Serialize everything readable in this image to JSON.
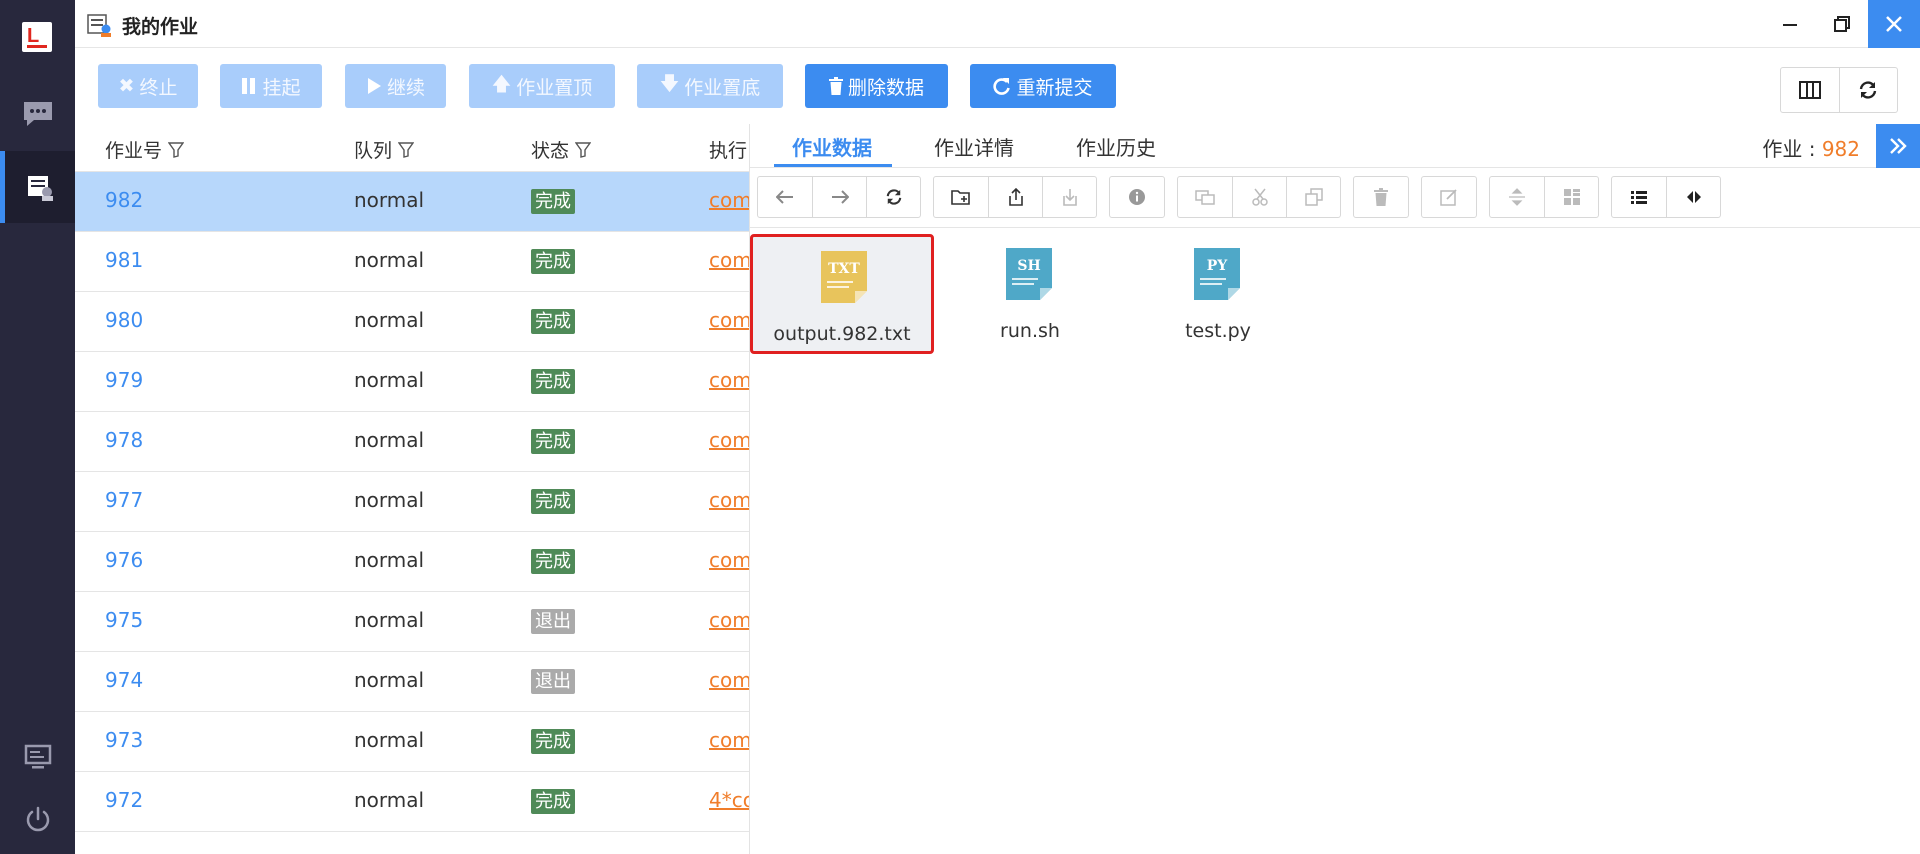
{
  "window": {
    "title": "我的作业"
  },
  "toolbar": {
    "terminate": "终止",
    "suspend": "挂起",
    "resume": "继续",
    "pin_top": "作业置顶",
    "pin_bottom": "作业置底",
    "delete_data": "删除数据",
    "resubmit": "重新提交"
  },
  "table": {
    "headers": {
      "job_id": "作业号",
      "queue": "队列",
      "status": "状态",
      "exec": "执行"
    },
    "rows": [
      {
        "id": "982",
        "queue": "normal",
        "status": "完成",
        "kind": "done",
        "cmd": "com",
        "selected": true
      },
      {
        "id": "981",
        "queue": "normal",
        "status": "完成",
        "kind": "done",
        "cmd": "com"
      },
      {
        "id": "980",
        "queue": "normal",
        "status": "完成",
        "kind": "done",
        "cmd": "com"
      },
      {
        "id": "979",
        "queue": "normal",
        "status": "完成",
        "kind": "done",
        "cmd": "com"
      },
      {
        "id": "978",
        "queue": "normal",
        "status": "完成",
        "kind": "done",
        "cmd": "com"
      },
      {
        "id": "977",
        "queue": "normal",
        "status": "完成",
        "kind": "done",
        "cmd": "com"
      },
      {
        "id": "976",
        "queue": "normal",
        "status": "完成",
        "kind": "done",
        "cmd": "com"
      },
      {
        "id": "975",
        "queue": "normal",
        "status": "退出",
        "kind": "exit",
        "cmd": "com"
      },
      {
        "id": "974",
        "queue": "normal",
        "status": "退出",
        "kind": "exit",
        "cmd": "com"
      },
      {
        "id": "973",
        "queue": "normal",
        "status": "完成",
        "kind": "done",
        "cmd": "com"
      },
      {
        "id": "972",
        "queue": "normal",
        "status": "完成",
        "kind": "done",
        "cmd": "4*co"
      }
    ]
  },
  "panel": {
    "tabs": [
      "作业数据",
      "作业详情",
      "作业历史"
    ],
    "job_label": "作业 : ",
    "job_number": "982",
    "files": [
      {
        "name": "output.982.txt",
        "type": "TXT",
        "color": "#e8c45c",
        "selected": true
      },
      {
        "name": "run.sh",
        "type": "SH",
        "color": "#4fa8c8"
      },
      {
        "name": "test.py",
        "type": "PY",
        "color": "#4fa8c8"
      }
    ]
  },
  "colors": {
    "accent": "#3c8cf0",
    "sidebar": "#28283d",
    "done": "#4f8a58",
    "exit": "#aaaaaa",
    "link": "#f07d2a"
  }
}
